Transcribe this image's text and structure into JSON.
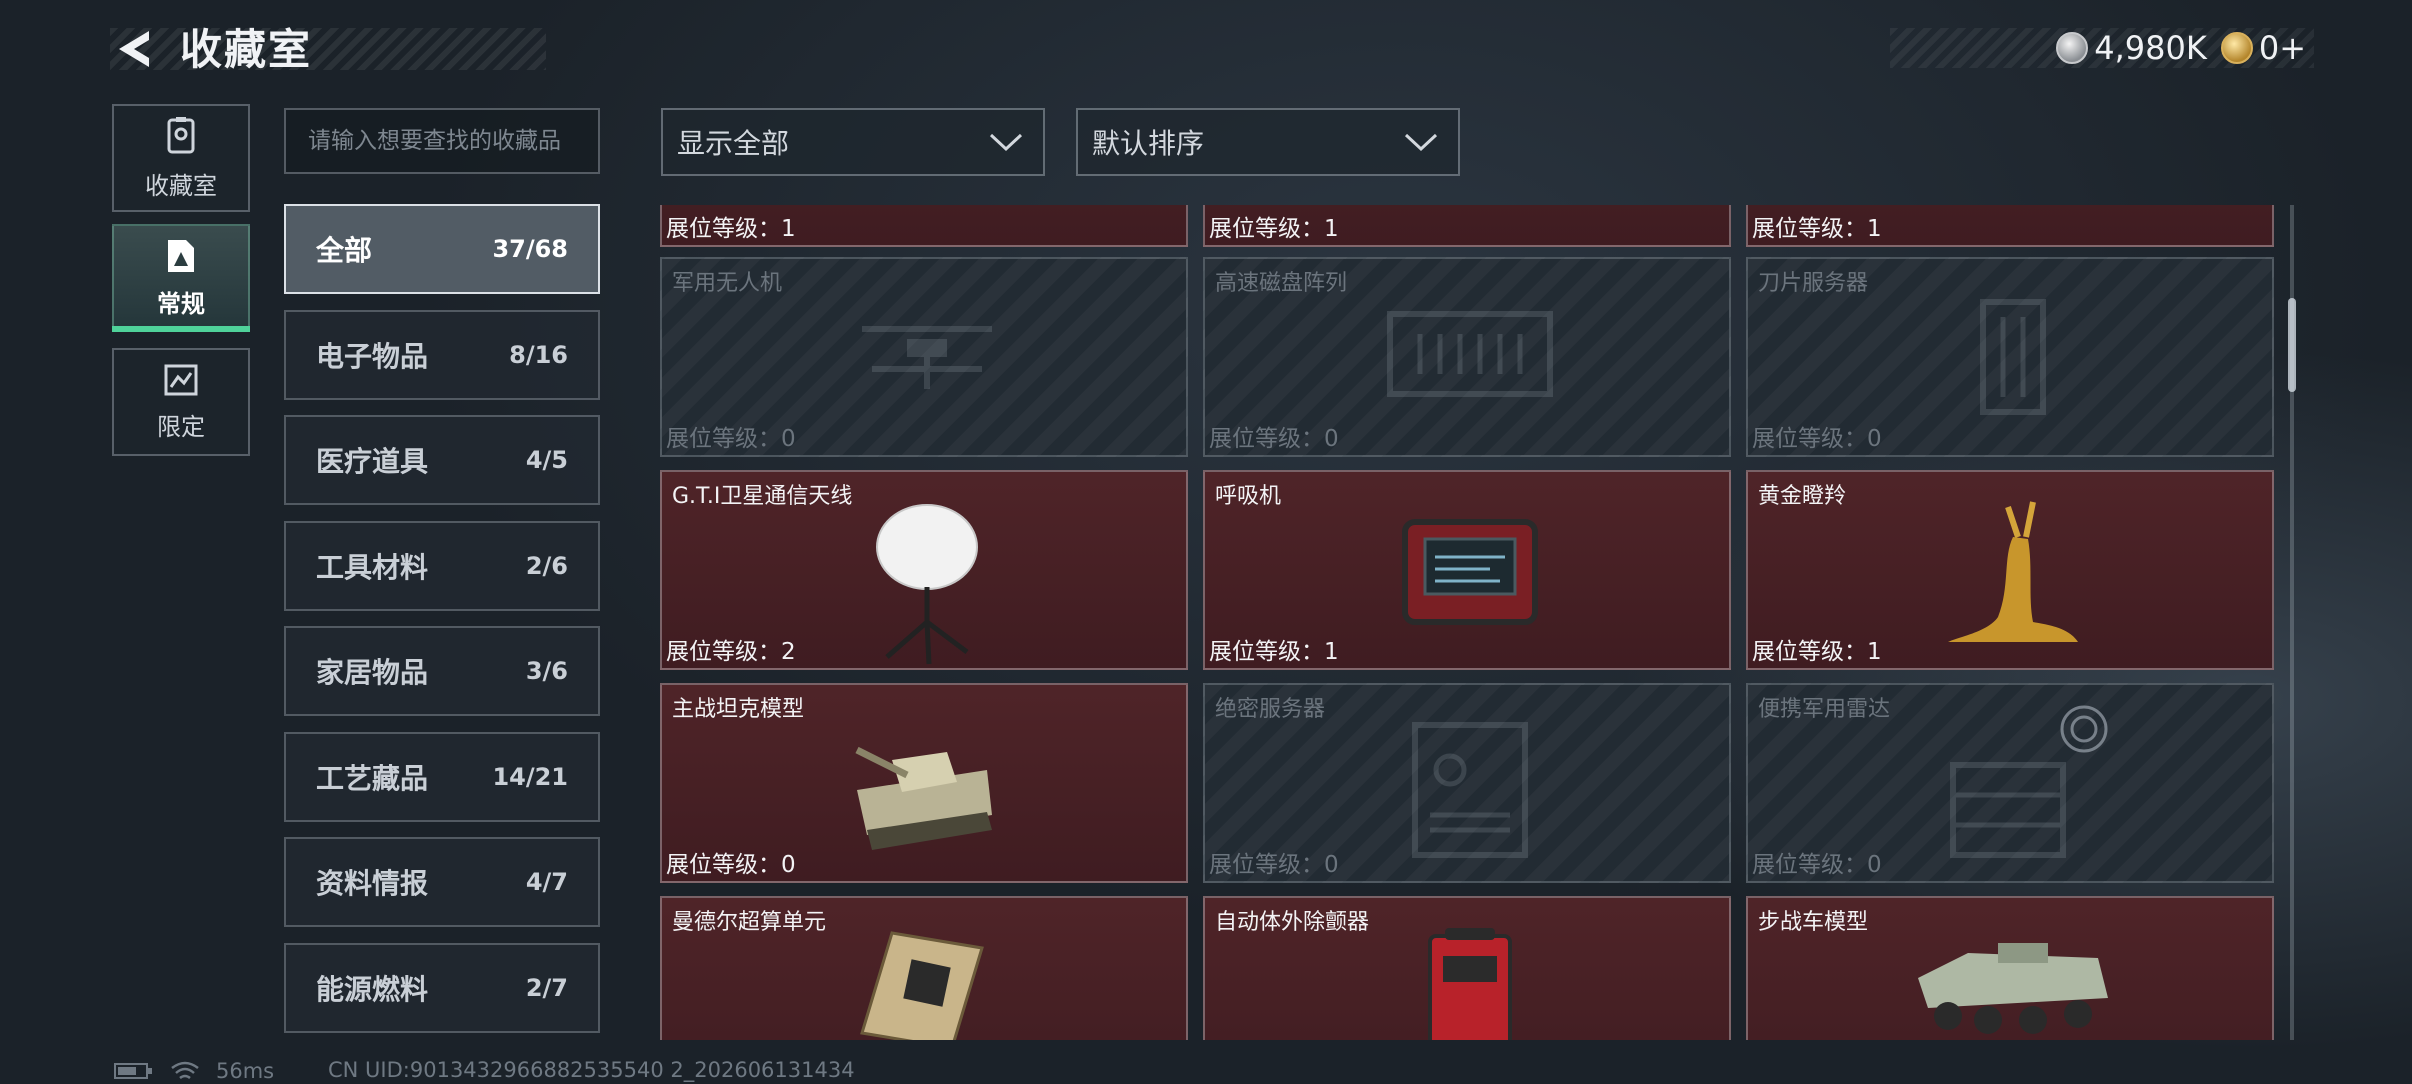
{
  "header": {
    "title": "收藏室",
    "currency": [
      {
        "icon": "silver-coin-icon",
        "value": "4,980K"
      },
      {
        "icon": "gold-coin-icon",
        "value": "0+"
      }
    ]
  },
  "nav": [
    {
      "label": "收藏室",
      "icon": "collection-room-icon"
    },
    {
      "label": "常规",
      "icon": "regular-items-icon"
    },
    {
      "label": "限定",
      "icon": "limited-items-icon"
    }
  ],
  "search": {
    "placeholder": "请输入想要查找的收藏品",
    "value": ""
  },
  "categories": [
    {
      "label": "全部",
      "count": "37/68"
    },
    {
      "label": "电子物品",
      "count": "8/16"
    },
    {
      "label": "医疗道具",
      "count": "4/5"
    },
    {
      "label": "工具材料",
      "count": "2/6"
    },
    {
      "label": "家居物品",
      "count": "3/6"
    },
    {
      "label": "工艺藏品",
      "count": "14/21"
    },
    {
      "label": "资料情报",
      "count": "4/7"
    },
    {
      "label": "能源燃料",
      "count": "2/7"
    }
  ],
  "filters": {
    "display": "显示全部",
    "sort": "默认排序"
  },
  "level_prefix": "展位等级：",
  "items": [
    {
      "name": "",
      "level": "展位等级：1",
      "owned": true
    },
    {
      "name": "",
      "level": "展位等级：1",
      "owned": true
    },
    {
      "name": "",
      "level": "展位等级：1",
      "owned": true
    },
    {
      "name": "军用无人机",
      "level": "展位等级：0",
      "owned": false
    },
    {
      "name": "高速磁盘阵列",
      "level": "展位等级：0",
      "owned": false
    },
    {
      "name": "刀片服务器",
      "level": "展位等级：0",
      "owned": false
    },
    {
      "name": "G.T.I卫星通信天线",
      "level": "展位等级：2",
      "owned": true
    },
    {
      "name": "呼吸机",
      "level": "展位等级：1",
      "owned": true
    },
    {
      "name": "黄金瞪羚",
      "level": "展位等级：1",
      "owned": true
    },
    {
      "name": "主战坦克模型",
      "level": "展位等级：0",
      "owned": true
    },
    {
      "name": "绝密服务器",
      "level": "展位等级：0",
      "owned": false
    },
    {
      "name": "便携军用雷达",
      "level": "展位等级：0",
      "owned": false
    },
    {
      "name": "曼德尔超算单元",
      "level": "",
      "owned": true
    },
    {
      "name": "自动体外除颤器",
      "level": "",
      "owned": true
    },
    {
      "name": "步战车模型",
      "level": "",
      "owned": true
    }
  ],
  "status": {
    "ping": "56ms",
    "uid": "CN UID:9013432966882535540 2_202606131434"
  }
}
